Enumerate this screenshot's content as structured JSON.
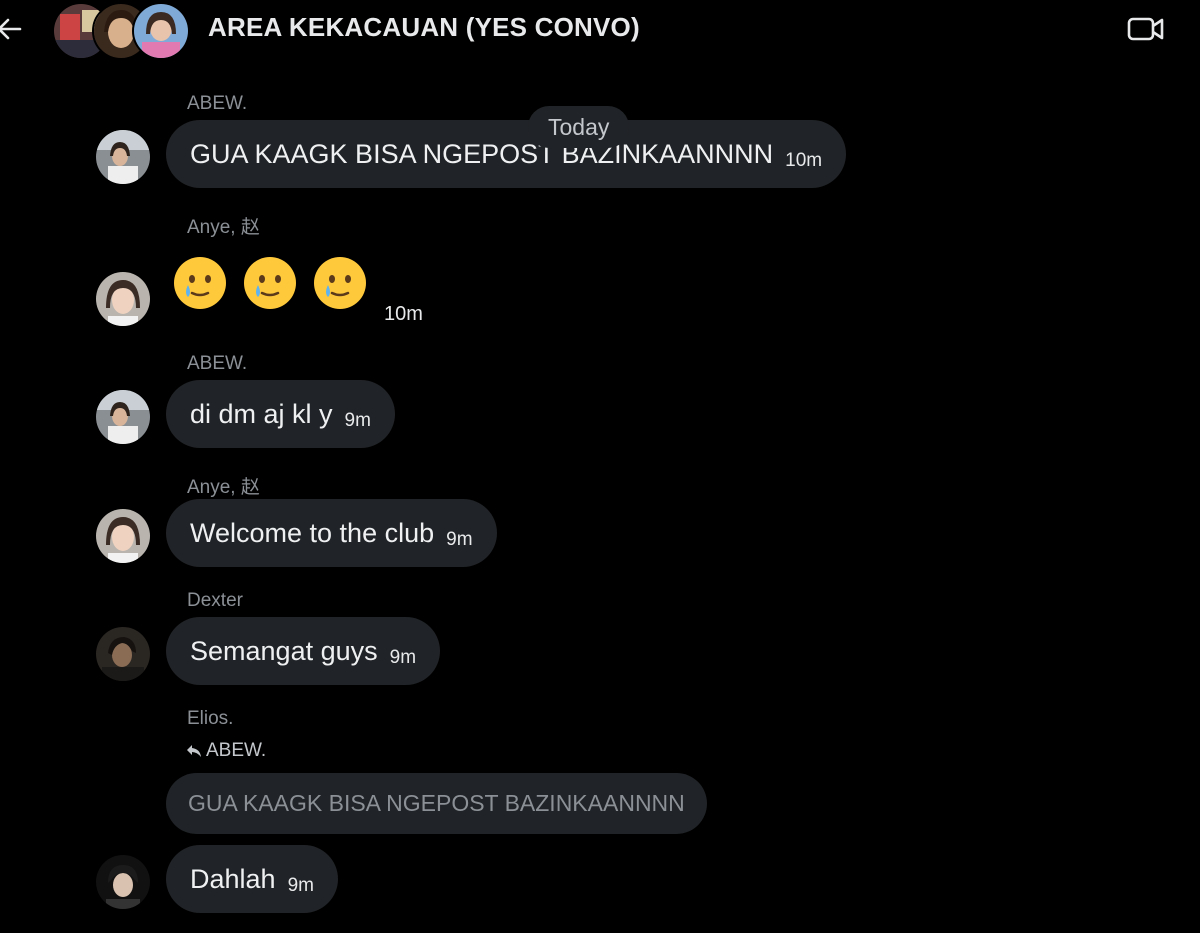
{
  "header": {
    "title": "AREA KEKACAUAN (YES CONVO)",
    "back_icon": "arrow-left-icon",
    "video_icon": "video-call-icon"
  },
  "date_divider": "Today",
  "messages": [
    {
      "sender": "ABEW.",
      "text": "GUA KAAGK BISA NGEPOST BAZINKAANNNN",
      "time": "10m"
    },
    {
      "sender": "Anye, 赵",
      "emojis": [
        "face-holding-back-tears",
        "face-holding-back-tears",
        "face-holding-back-tears"
      ],
      "time": "10m"
    },
    {
      "sender": "ABEW.",
      "text": "di dm aj kl y",
      "time": "9m"
    },
    {
      "sender": "Anye, 赵",
      "text": "Welcome to the club",
      "time": "9m"
    },
    {
      "sender": "Dexter",
      "text": "Semangat guys",
      "time": "9m"
    },
    {
      "sender": "Elios.",
      "reply_to": "ABEW.",
      "quoted": "GUA KAAGK BISA NGEPOST BAZINKAANNNN",
      "text": "Dahlah",
      "time": "9m"
    }
  ],
  "colors": {
    "background": "#000000",
    "bubble": "#202327",
    "muted_text": "#8b9096"
  }
}
